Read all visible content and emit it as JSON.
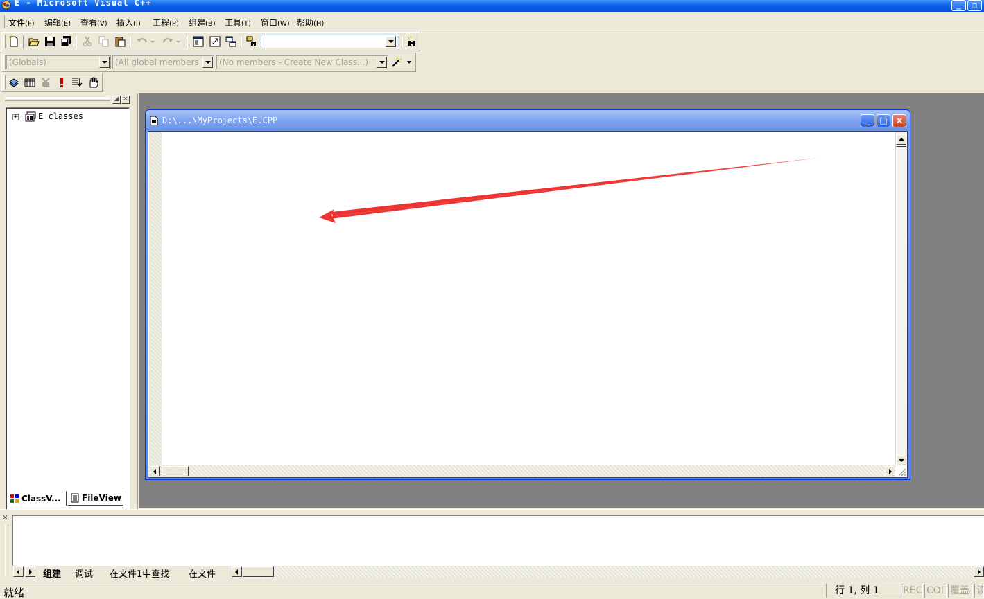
{
  "window": {
    "title": "E - Microsoft Visual C++",
    "minimize_glyph": "_",
    "restore_glyph": "❐"
  },
  "menu": [
    {
      "label": "文件",
      "accel": "(F)"
    },
    {
      "label": "编辑",
      "accel": "(E)"
    },
    {
      "label": "查看",
      "accel": "(V)"
    },
    {
      "label": "插入",
      "accel": "(I)"
    },
    {
      "label": "工程",
      "accel": "(P)"
    },
    {
      "label": "组建",
      "accel": "(B)"
    },
    {
      "label": "工具",
      "accel": "(T)"
    },
    {
      "label": "窗口",
      "accel": "(W)"
    },
    {
      "label": "帮助",
      "accel": "(H)"
    }
  ],
  "wizardbar": {
    "class_combo": "(Globals)",
    "filter_combo": "(All global members",
    "members_combo": "(No members - Create New Class...)"
  },
  "standard_toolbar": {
    "find_combo_value": ""
  },
  "workspace": {
    "tree_root": "E classes",
    "tree_expander": "+",
    "tabs": [
      "ClassV...",
      "FileView"
    ],
    "pin_glyph": "◢",
    "close_glyph": "×"
  },
  "document": {
    "title": "D:\\...\\MyProjects\\E.CPP",
    "minimize_glyph": "_",
    "maximize_glyph": "□",
    "close_glyph": "×"
  },
  "output": {
    "close_glyph": "×",
    "tabs": [
      "组建",
      "调试",
      "在文件1中查找",
      "在文件"
    ]
  },
  "status": {
    "message": "就绪",
    "position": "行 1, 列 1",
    "indicators": [
      "REC",
      "COL",
      "覆盖",
      "读"
    ]
  },
  "colors": {
    "face": "#ece9d8",
    "title_blue": "#0a5fe8",
    "mdi_bg": "#808080",
    "annotation_arrow": "#ee3333"
  }
}
